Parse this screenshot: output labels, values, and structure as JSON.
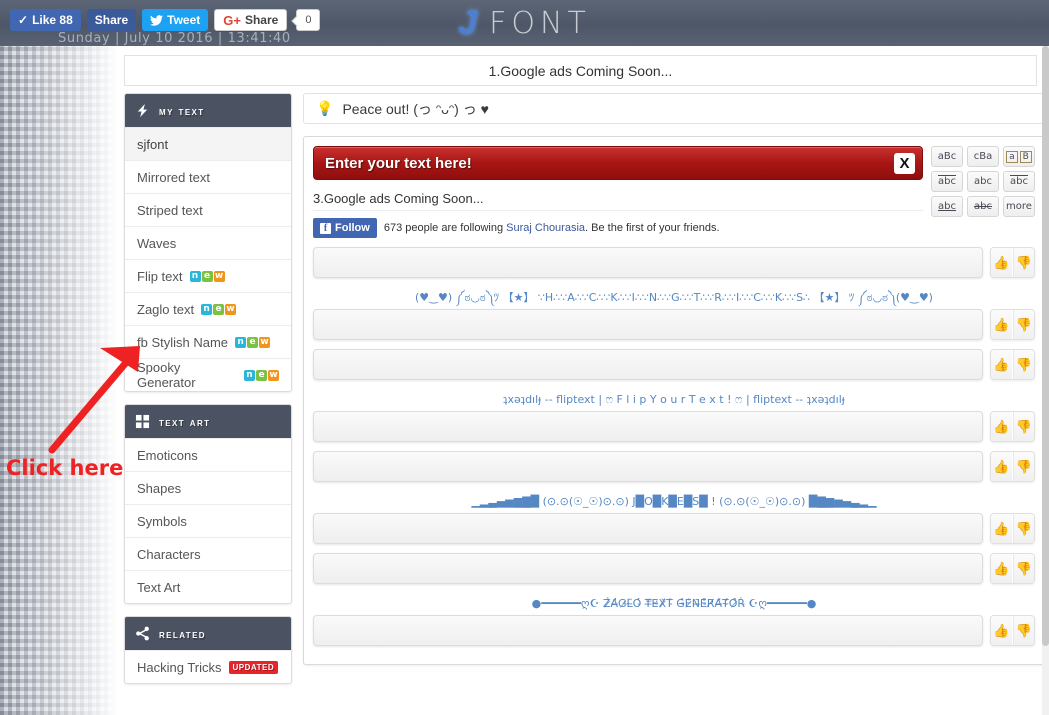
{
  "header": {
    "logo_j": "J",
    "logo_text": "FONT",
    "datetime": "Sunday | July 10 2016 | 13:41:40",
    "social": {
      "like_label": "Like 88",
      "like_tick": "✓",
      "share_label": "Share",
      "tweet_label": "Tweet",
      "tweet_icon": "twitter-bird-icon",
      "gplus_g": "G+",
      "gplus_label": "Share",
      "gplus_count": "0"
    }
  },
  "ads": {
    "top": "1.Google ads Coming Soon...",
    "inline": "3.Google ads Coming Soon..."
  },
  "tipbar": {
    "icon": "lightbulb-icon",
    "text": "Peace out! (っ ᵔᴗᵔ) っ ♥"
  },
  "sidebar": {
    "panels": [
      {
        "title": "my text",
        "icon": "lightning-icon",
        "items": [
          {
            "label": "sjfont",
            "active": true,
            "badge": ""
          },
          {
            "label": "Mirrored text",
            "active": false,
            "badge": ""
          },
          {
            "label": "Striped text",
            "active": false,
            "badge": ""
          },
          {
            "label": "Waves",
            "active": false,
            "badge": ""
          },
          {
            "label": "Flip text",
            "active": false,
            "badge": "new"
          },
          {
            "label": "Zaglo text",
            "active": false,
            "badge": "new"
          },
          {
            "label": "fb Stylish Name",
            "active": false,
            "badge": "new"
          },
          {
            "label": "Spooky Generator",
            "active": false,
            "badge": "new"
          }
        ]
      },
      {
        "title": "text art",
        "icon": "grid-icon",
        "items": [
          {
            "label": "Emoticons",
            "active": false,
            "badge": ""
          },
          {
            "label": "Shapes",
            "active": false,
            "badge": ""
          },
          {
            "label": "Symbols",
            "active": false,
            "badge": ""
          },
          {
            "label": "Characters",
            "active": false,
            "badge": ""
          },
          {
            "label": "Text Art",
            "active": false,
            "badge": ""
          }
        ]
      },
      {
        "title": "related",
        "icon": "share-nodes-icon",
        "items": [
          {
            "label": "Hacking Tricks",
            "active": false,
            "badge": "UPDATED"
          }
        ]
      }
    ],
    "badge_new_letters": [
      "n",
      "e",
      "w"
    ]
  },
  "editor": {
    "input_value": "Enter your text here!",
    "clear_label": "X",
    "style_buttons": [
      {
        "label": "aBc",
        "name": "style-normal"
      },
      {
        "label": "cBa",
        "name": "style-reversed"
      },
      {
        "label": "a|B",
        "name": "style-boxed"
      },
      {
        "label": "abc",
        "name": "style-wavy"
      },
      {
        "label": "abc",
        "name": "style-sparkle"
      },
      {
        "label": "abc",
        "name": "style-overline"
      },
      {
        "label": "abc",
        "name": "style-underline"
      },
      {
        "label": "abc",
        "name": "style-strikethrough"
      },
      {
        "label": "more",
        "name": "style-more"
      }
    ]
  },
  "facebook": {
    "follow_label": "Follow",
    "f_glyph": "f",
    "count_text": "673 people are following ",
    "page_name": "Suraj Chourasia",
    "tail_text": ". Be the first of your friends."
  },
  "results": {
    "vote_up": "👍",
    "vote_down": "👎",
    "rows": [
      {
        "text": "",
        "has_box": true
      },
      {
        "text": "(♥‿♥) ༼ಠ◡ಠ༽ﾂ 【★】 ∵H∴∵A∴∵C∴∵K∴∵I∴∵N∴∵G∴∵T∴∵R∴∵I∴∵C∴∵K∴∵S∴ 【★】 ﾂ ༼ಠ◡ಠ༽(♥‿♥)",
        "has_box": false
      },
      {
        "text": "",
        "has_box": true
      },
      {
        "text": "",
        "has_box": true
      },
      {
        "text": "ʇxǝʇdılɟ -- fliptext | ෆ F l i p  Y o u r  T e x t !  ෆ | fliptext -- ʇxǝʇdılɟ",
        "has_box": false
      },
      {
        "text": "",
        "has_box": true
      },
      {
        "text": "",
        "has_box": true
      },
      {
        "text": "▁▂▃▄▅▆▇█ (⊙.⊙(☉_☉)⊙.⊙) J█O█K█E█S█ ! (⊙.⊙(☉_☉)⊙.⊙) █▇▆▅▄▃▂▁",
        "has_box": false
      },
      {
        "text": "",
        "has_box": true
      },
      {
        "text": "",
        "has_box": true
      },
      {
        "text": "●━━━━━━ღ☪ Z̷̐A̶̓G̷̒L̴̃O̵̔ T̶̿E̴̒X̷̌T̵̉ G̴̽E̷̍N̶̄E̵̊R̸̈A̶̽T̴̾O̷̊Ṙ̵ ☪ღ━━━━━━●",
        "has_box": false
      },
      {
        "text": "",
        "has_box": true
      },
      {
        "text": "",
        "has_box": true
      }
    ]
  },
  "annotation": {
    "click_here": "Click here"
  }
}
